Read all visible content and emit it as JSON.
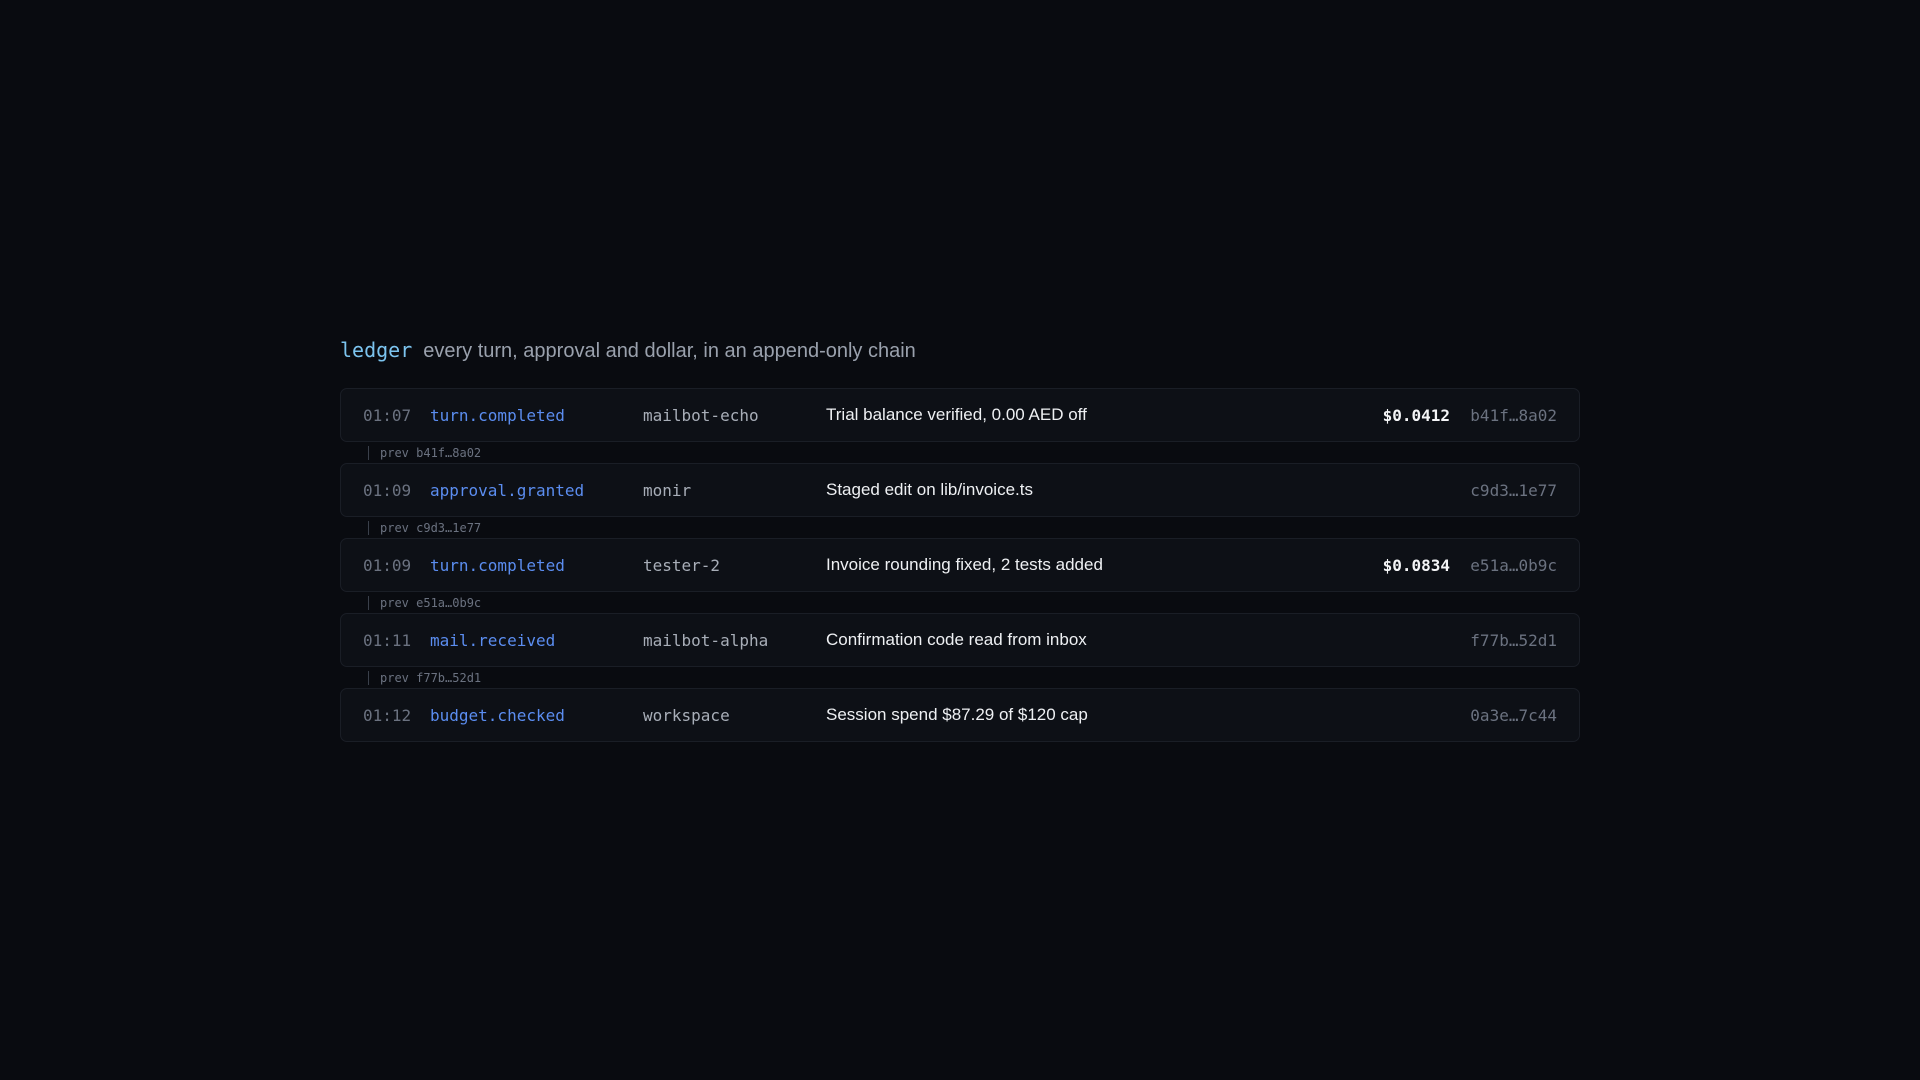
{
  "header": {
    "title": "ledger",
    "subtitle": "every turn, approval and dollar, in an append-only chain"
  },
  "entries": [
    {
      "time": "01:07",
      "kind": "turn.completed",
      "actor": "mailbot-echo",
      "description": "Trial balance verified, 0.00 AED off",
      "cost": "$0.0412",
      "hash": "b41f…8a02"
    },
    {
      "time": "01:09",
      "kind": "approval.granted",
      "actor": "monir",
      "description": "Staged edit on lib/invoice.ts",
      "cost": "",
      "hash": "c9d3…1e77"
    },
    {
      "time": "01:09",
      "kind": "turn.completed",
      "actor": "tester-2",
      "description": "Invoice rounding fixed, 2 tests added",
      "cost": "$0.0834",
      "hash": "e51a…0b9c"
    },
    {
      "time": "01:11",
      "kind": "mail.received",
      "actor": "mailbot-alpha",
      "description": "Confirmation code read from inbox",
      "cost": "",
      "hash": "f77b…52d1"
    },
    {
      "time": "01:12",
      "kind": "budget.checked",
      "actor": "workspace",
      "description": "Session spend $87.29 of $120 cap",
      "cost": "",
      "hash": "0a3e…7c44"
    }
  ],
  "links": [
    {
      "label": "prev b41f…8a02"
    },
    {
      "label": "prev c9d3…1e77"
    },
    {
      "label": "prev e51a…0b9c"
    },
    {
      "label": "prev f77b…52d1"
    }
  ],
  "colors": {
    "background": "#090b10",
    "accent_title": "#7cc4ef",
    "event_kind": "#5b8df0"
  }
}
